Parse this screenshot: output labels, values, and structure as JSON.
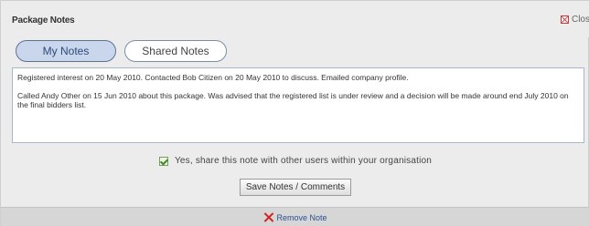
{
  "panel": {
    "title": "Package Notes",
    "close_label": "Clos"
  },
  "tabs": [
    {
      "label": "My Notes",
      "active": true
    },
    {
      "label": "Shared Notes",
      "active": false
    }
  ],
  "notes": {
    "lines": [
      "Registered interest on 20 May 2010. Contacted Bob Citizen on 20 May 2010 to discuss. Emailed company profile.",
      "Called Andy Other on 15 Jun 2010 about this package. Was advised that the registered list is under review and a decision will be made around end July 2010 on the final bidders list."
    ]
  },
  "share": {
    "checked": true,
    "label": "Yes, share this note with other users within your organisation"
  },
  "save_button": {
    "label": "Save Notes / Comments"
  },
  "remove": {
    "label": "Remove Note"
  },
  "colors": {
    "panel_bg": "#ececec",
    "tab_active_bg": "#c9d6ec",
    "remove_icon": "#d32020",
    "link": "#2a4f93"
  }
}
